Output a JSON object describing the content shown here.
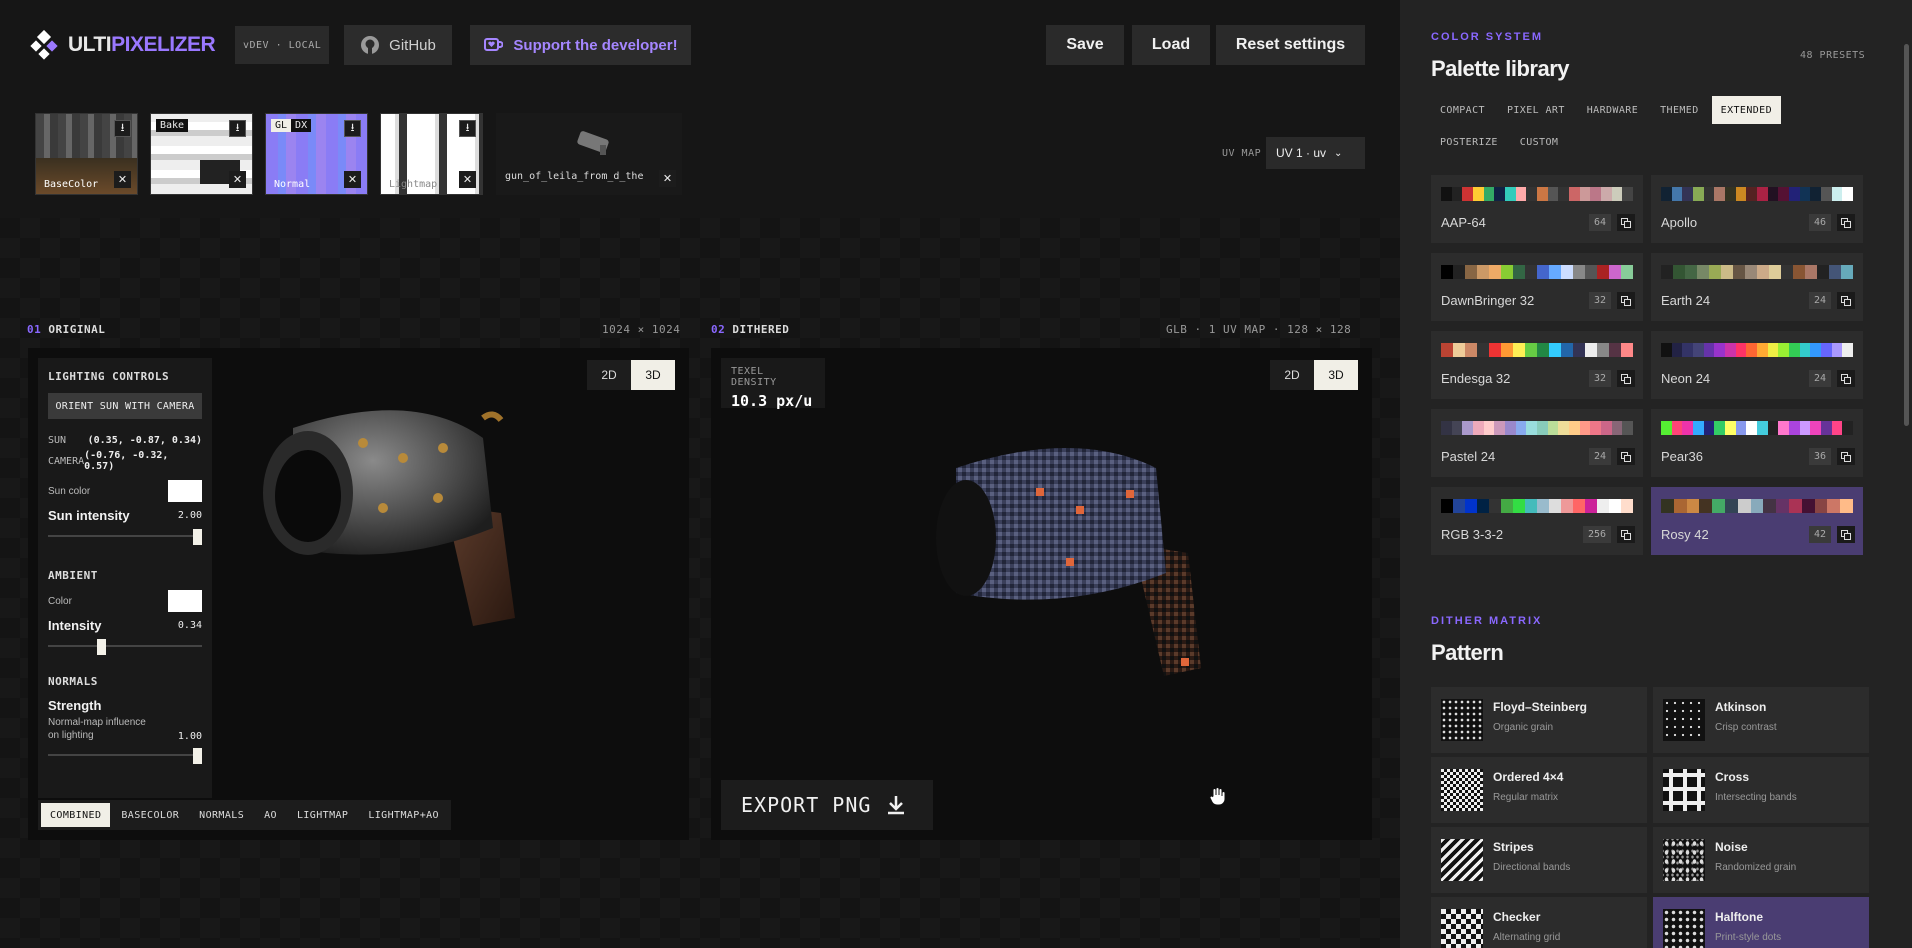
{
  "app": {
    "logo_light": "ULTI",
    "logo_accent": "PIXELIZER",
    "version": "vDEV · LOCAL"
  },
  "header": {
    "github": "GitHub",
    "support": "Support the developer!",
    "save": "Save",
    "load": "Load",
    "reset": "Reset settings"
  },
  "textures": [
    {
      "label": "BaseColor"
    },
    {
      "label": "",
      "top_tag": "Bake"
    },
    {
      "label": "Normal",
      "tag_a": "GL",
      "tag_b": "DX"
    },
    {
      "label": "Lightmap"
    },
    {
      "label": "gun_of_leila_from_d_the"
    }
  ],
  "uv": {
    "label": "UV MAP",
    "value": "UV 1 · uv"
  },
  "original": {
    "num": "01",
    "title": "ORIGINAL",
    "dims": "1024 × 1024",
    "mode_2d": "2D",
    "mode_3d": "3D"
  },
  "dithered": {
    "num": "02",
    "title": "DITHERED",
    "info": "GLB · 1 UV MAP · 128 × 128",
    "mode_2d": "2D",
    "mode_3d": "3D",
    "texel_label": "TEXEL DENSITY",
    "texel_value": "10.3 px/u",
    "export": "EXPORT PNG"
  },
  "lighting": {
    "title": "LIGHTING CONTROLS",
    "orient": "ORIENT SUN WITH CAMERA",
    "sun_label": "SUN",
    "sun_value": "(0.35, -0.87, 0.34)",
    "camera_label": "CAMERA",
    "camera_value": "(-0.76, -0.32, 0.57)",
    "sun_color": "Sun color",
    "sun_intensity_label": "Sun intensity",
    "sun_intensity": "2.00",
    "sun_intensity_frac": 1.0,
    "ambient_title": "AMBIENT",
    "ambient_color": "Color",
    "ambient_intensity_label": "Intensity",
    "ambient_intensity": "0.34",
    "ambient_frac": 0.34,
    "normals_title": "NORMALS",
    "strength_label": "Strength",
    "strength_desc": "Normal-map influence on lighting",
    "strength": "1.00",
    "strength_frac": 1.0
  },
  "modes": [
    "COMBINED",
    "BASECOLOR",
    "NORMALS",
    "AO",
    "LIGHTMAP",
    "LIGHTMAP+AO"
  ],
  "sidebar": {
    "kicker": "COLOR SYSTEM",
    "title": "Palette library",
    "presets": "48 PRESETS",
    "tabs": [
      "COMPACT",
      "PIXEL ART",
      "HARDWARE",
      "THEMED",
      "EXTENDED",
      "POSTERIZE",
      "CUSTOM"
    ],
    "palettes": [
      {
        "name": "AAP-64",
        "count": "64",
        "colors": [
          "#111",
          "#222",
          "#c33",
          "#fc3",
          "#3a6",
          "#124",
          "#3cb",
          "#faa",
          "#333",
          "#c74",
          "#555",
          "#333",
          "#c66",
          "#c99",
          "#b78",
          "#caa",
          "#ccb",
          "#444"
        ]
      },
      {
        "name": "Apollo",
        "count": "46",
        "colors": [
          "#123",
          "#47a",
          "#335",
          "#8a5",
          "#333",
          "#a76",
          "#332",
          "#c82",
          "#522",
          "#a24",
          "#212",
          "#513",
          "#227",
          "#135",
          "#123",
          "#555",
          "#cee",
          "#fff"
        ]
      },
      {
        "name": "DawnBringer 32",
        "count": "32",
        "colors": [
          "#000",
          "#222",
          "#864",
          "#c96",
          "#ea6",
          "#8c3",
          "#364",
          "#333",
          "#46c",
          "#6af",
          "#cdf",
          "#888",
          "#555",
          "#a22",
          "#c6c",
          "#8c9"
        ]
      },
      {
        "name": "Earth 24",
        "count": "24",
        "colors": [
          "#222",
          "#353",
          "#464",
          "#786",
          "#9a5",
          "#cb8",
          "#654",
          "#987",
          "#ca8",
          "#dc9",
          "#333",
          "#853",
          "#a76",
          "#222",
          "#457",
          "#6ab"
        ]
      },
      {
        "name": "Endesga 32",
        "count": "32",
        "colors": [
          "#b43",
          "#ec9",
          "#c86",
          "#333",
          "#e33",
          "#f93",
          "#fe5",
          "#6c4",
          "#284",
          "#3cf",
          "#26a",
          "#335",
          "#eee",
          "#888",
          "#534",
          "#f88"
        ]
      },
      {
        "name": "Neon 24",
        "count": "24",
        "colors": [
          "#111",
          "#224",
          "#336",
          "#447",
          "#63a",
          "#93c",
          "#c3a",
          "#f36",
          "#f63",
          "#fa3",
          "#ee4",
          "#9e3",
          "#3c5",
          "#3cc",
          "#39f",
          "#66f",
          "#a9f",
          "#eee"
        ]
      },
      {
        "name": "Pastel 24",
        "count": "24",
        "colors": [
          "#334",
          "#445",
          "#a9c",
          "#eab",
          "#fcc",
          "#c9b",
          "#98c",
          "#8ae",
          "#9dd",
          "#8cb",
          "#bd9",
          "#ed9",
          "#fc8",
          "#f98",
          "#e78",
          "#c68",
          "#867",
          "#555"
        ]
      },
      {
        "name": "Pear36",
        "count": "36",
        "colors": [
          "#5e3",
          "#f47",
          "#e3a",
          "#3af",
          "#227",
          "#3c6",
          "#ff6",
          "#89e",
          "#fff",
          "#4cd",
          "#222",
          "#f7c",
          "#a4d",
          "#c9f",
          "#e4b",
          "#639",
          "#f48",
          "#222"
        ]
      },
      {
        "name": "RGB 3-3-2",
        "count": "256",
        "colors": [
          "#000",
          "#249",
          "#03c",
          "#024",
          "#333",
          "#4a4",
          "#3d4",
          "#4bb",
          "#9bc",
          "#ddd",
          "#e99",
          "#f66",
          "#c29",
          "#eee",
          "#fff",
          "#fdc"
        ]
      },
      {
        "name": "Rosy 42",
        "count": "42",
        "colors": [
          "#332",
          "#a63",
          "#c84",
          "#432",
          "#4a6",
          "#345",
          "#ccc",
          "#8ab",
          "#434",
          "#636",
          "#a35",
          "#413",
          "#844",
          "#c76",
          "#fb8"
        ]
      }
    ],
    "dither_kicker": "DITHER MATRIX",
    "dither_title": "Pattern",
    "patterns": [
      {
        "name": "Floyd–Steinberg",
        "desc": "Organic grain",
        "kind": "dots"
      },
      {
        "name": "Atkinson",
        "desc": "Crisp contrast",
        "kind": "sparse"
      },
      {
        "name": "Ordered 4×4",
        "desc": "Regular matrix",
        "kind": "check"
      },
      {
        "name": "Cross",
        "desc": "Intersecting bands",
        "kind": "cross"
      },
      {
        "name": "Stripes",
        "desc": "Directional bands",
        "kind": "stripes"
      },
      {
        "name": "Noise",
        "desc": "Randomized grain",
        "kind": "noise"
      },
      {
        "name": "Checker",
        "desc": "Alternating grid",
        "kind": "check2"
      },
      {
        "name": "Halftone",
        "desc": "Print-style dots",
        "kind": "half"
      }
    ]
  },
  "colors": {
    "accent": "#8a68ff",
    "selected": "#4a3d72"
  }
}
